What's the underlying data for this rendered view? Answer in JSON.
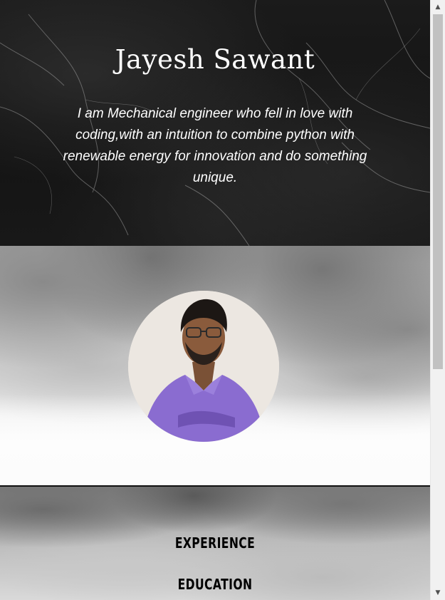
{
  "hero": {
    "name": "Jayesh Sawant",
    "bio": "I am Mechanical engineer who fell in love with coding,with an intuition to combine python with renewable energy for innovation and do something unique."
  },
  "profile": {
    "avatar_icon": "profile-photo-icon"
  },
  "nav": {
    "experience": "EXPERIENCE",
    "education": "EDUCATION"
  },
  "scrollbar": {
    "up_icon": "arrow-up-icon",
    "down_icon": "arrow-down-icon"
  },
  "colors": {
    "hero_bg": "#161616",
    "text_light": "#ffffff",
    "text_dark": "#000000",
    "avatar_bg": "#ece7e1",
    "shirt": "#8a6cd0"
  }
}
